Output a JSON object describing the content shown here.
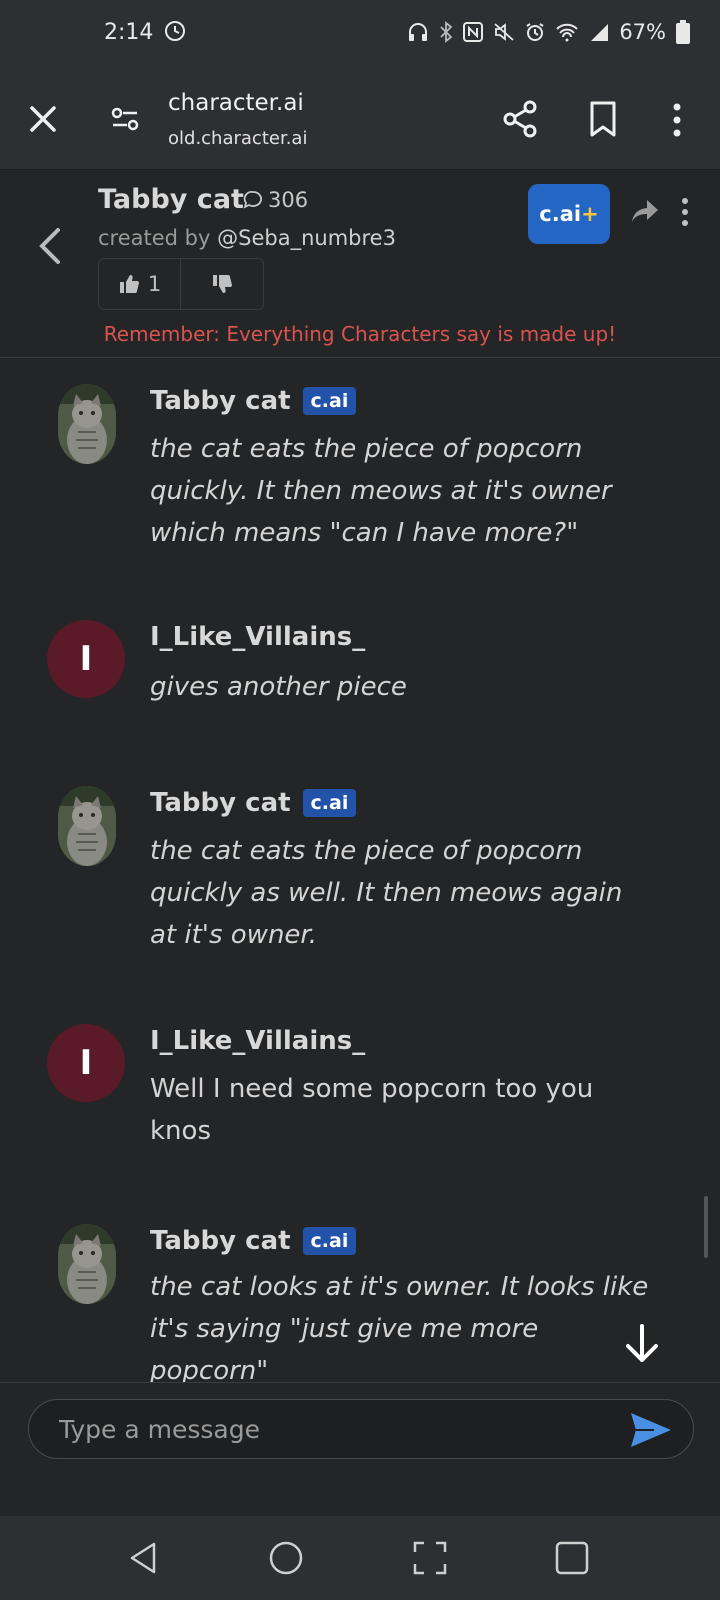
{
  "status_bar": {
    "time": "2:14",
    "battery": "67%"
  },
  "browser": {
    "title": "character.ai",
    "url": "old.character.ai"
  },
  "header": {
    "character_name": "Tabby cat",
    "chat_count": "306",
    "created_by_label": "created by",
    "creator_handle": "@Seba_numbre3",
    "like_count": "1",
    "cai_plus_label": "c.ai",
    "cai_plus_suffix": "+",
    "disclaimer": "Remember: Everything Characters say is made up!"
  },
  "messages": [
    {
      "sender": "Tabby cat",
      "badge": "c.ai",
      "text": "the cat eats the piece of popcorn quickly. It then meows at it's owner which means \"can I have more?\""
    },
    {
      "sender": "I_Like_Villains_",
      "avatar_letter": "I",
      "text": "gives another piece"
    },
    {
      "sender": "Tabby cat",
      "badge": "c.ai",
      "text": "the cat eats the piece of popcorn quickly as well. It then meows again at it's owner."
    },
    {
      "sender": "I_Like_Villains_",
      "avatar_letter": "I",
      "text": "Well I need some popcorn too you knos"
    },
    {
      "sender": "Tabby cat",
      "badge": "c.ai",
      "text": "the cat looks at it's owner. It looks like it's saying \"just give me more popcorn\""
    }
  ],
  "input": {
    "placeholder": "Type a message"
  },
  "colors": {
    "accent": "#2466c4",
    "badge": "#2353a8",
    "user_avatar": "#5b1a28",
    "disclaimer": "#d9534f",
    "send": "#4a90e2"
  }
}
